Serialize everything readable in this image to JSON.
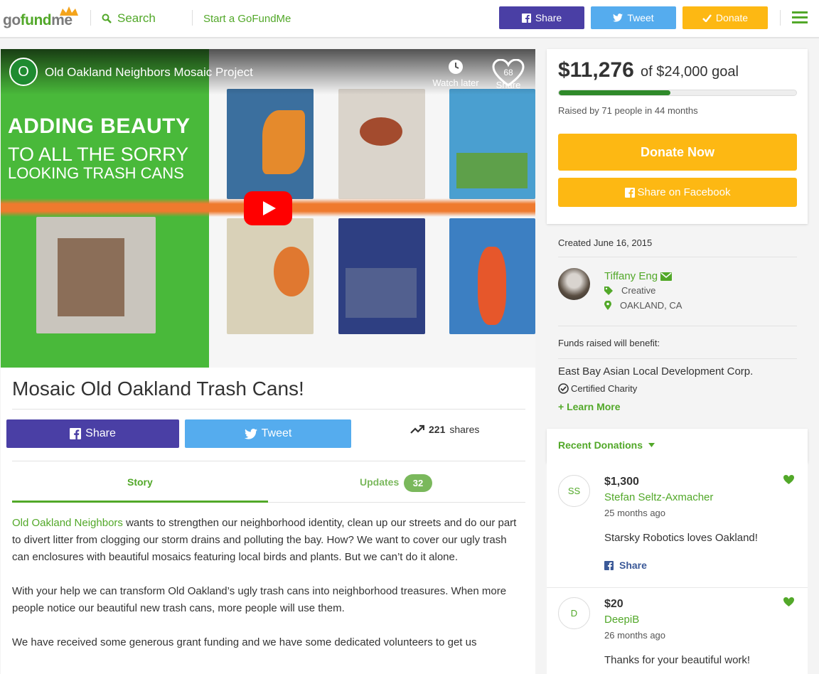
{
  "header": {
    "logo": "gofundme",
    "search_label": "Search",
    "start_label": "Start a GoFundMe",
    "share_label": "Share",
    "tweet_label": "Tweet",
    "donate_label": "Donate",
    "icons": {
      "search": "search-icon",
      "menu": "hamburger-menu-icon"
    }
  },
  "video": {
    "channel_initial": "O",
    "title": "Old Oakland Neighbors Mosaic Project",
    "watch_later": "Watch later",
    "share_label": "Share",
    "like_count": "68",
    "slide_line1": "ADDING BEAUTY",
    "slide_line2": "TO ALL THE SORRY",
    "slide_line3": "LOOKING TRASH CANS"
  },
  "campaign": {
    "title": "Mosaic Old Oakland Trash Cans!",
    "share_label": "Share",
    "tweet_label": "Tweet",
    "share_count": "221",
    "share_suffix": "shares",
    "tabs": {
      "story": "Story",
      "updates": "Updates",
      "updates_count": "32"
    },
    "story_org": "Old Oakland Neighbors",
    "story_p1": " wants to strengthen our neighborhood identity, clean up our streets and do our part to divert litter from clogging our storm drains and polluting the bay.  How? We want to cover our ugly trash can enclosures with beautiful mosaics featuring local birds and plants.  But we can’t do it alone.",
    "story_p2": "With your help we can transform Old Oakland’s ugly trash cans into neighborhood treasures.  When more people notice our beautiful new trash cans, more people will use them.",
    "story_p3": "We have received some generous grant funding and we have some dedicated volunteers to get us"
  },
  "sidebar": {
    "raised": "$11,276",
    "goal": "of $24,000 goal",
    "progress_fraction": 0.47,
    "raised_by": "Raised by 71 people in 44 months",
    "donate_now": "Donate Now",
    "share_facebook": "Share on Facebook",
    "created": "Created June 16, 2015",
    "organizer": {
      "name": "Tiffany Eng",
      "category": "Creative",
      "location": "OAKLAND, CA"
    },
    "funds_label": "Funds raised will benefit:",
    "charity_name": "East Bay Asian Local Development Corp.",
    "certified": "Certified Charity",
    "learn_more": "+ Learn More",
    "recent_donations_title": "Recent Donations",
    "donations": [
      {
        "initials": "SS",
        "amount": "$1,300",
        "name": "Stefan Seltz-Axmacher",
        "time": "25 months ago",
        "message": "Starsky Robotics loves Oakland!",
        "share": "Share"
      },
      {
        "initials": "D",
        "amount": "$20",
        "name": "DeepiB",
        "time": "26 months ago",
        "message": "Thanks for your beautiful work!"
      }
    ]
  },
  "colors": {
    "brand_green": "#52a829",
    "facebook": "#4a3fa5",
    "twitter": "#55acee",
    "donate": "#fdb813"
  }
}
